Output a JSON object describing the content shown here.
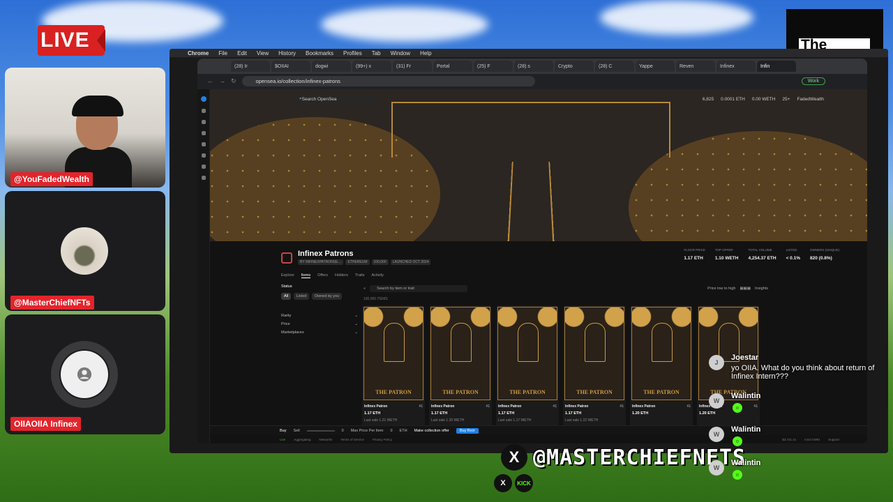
{
  "overlay": {
    "live_label": "LIVE",
    "brand_text": "The Crypto Bunker",
    "handle_text": "@MASTERCHIEFNFTS",
    "x_icon": "X",
    "kick_icon": "KICK"
  },
  "cams": [
    {
      "name": "@YouFadedWealth"
    },
    {
      "name": "@MasterChiefNFTs"
    },
    {
      "name": "OIIAOIIA Infinex"
    }
  ],
  "mac_menu": [
    "Chrome",
    "File",
    "Edit",
    "View",
    "History",
    "Bookmarks",
    "Profiles",
    "Tab",
    "Window",
    "Help"
  ],
  "browser": {
    "tabs": [
      "(28) Ir",
      "$OIIAI",
      "dogwi",
      "(99+) x",
      "(31) Fr",
      "Portal",
      "(25) F",
      "(28) s",
      "Crypto",
      "(28) C",
      "Yappe",
      "Reven",
      "Infinex",
      "Infin"
    ],
    "url": "opensea.io/collection/infinex-patrons",
    "work_label": "Work"
  },
  "opensea": {
    "search_placeholder": "Search OpenSea",
    "nav_stats": [
      "6,825",
      "0.0001 ETH",
      "0.00 WETH",
      "25+",
      "FadedWealth"
    ],
    "collection_name": "Infinex Patrons",
    "chips": [
      "BY INFINEXPATRONSE…",
      "ETHEREUM",
      "100,000",
      "LAUNCHED OCT 2024"
    ],
    "stats": [
      {
        "label": "FLOOR PRICE",
        "value": "1.17 ETH"
      },
      {
        "label": "TOP OFFER",
        "value": "1.10 WETH"
      },
      {
        "label": "TOTAL VOLUME",
        "value": "4,254.37 ETH"
      },
      {
        "label": "LISTED",
        "value": "< 0.1%"
      },
      {
        "label": "OWNERS (UNIQUE)",
        "value": "820 (0.8%)"
      }
    ],
    "subtabs": [
      "Explore",
      "Items",
      "Offers",
      "Holders",
      "Traits",
      "Activity"
    ],
    "status_label": "Status",
    "status_pills": [
      "All",
      "Listed",
      "Owned by you"
    ],
    "filter_rows": [
      "Rarity",
      "Price",
      "Marketplaces"
    ],
    "item_search_placeholder": "Search by item or trait",
    "sort_label": "Price low to high",
    "insights_label": "Insights",
    "items_count": "100,000 ITEMS",
    "cards": [
      {
        "name": "Infinex Patron",
        "rank": "#1",
        "price": "1.17 ETH",
        "last": "Last sale 1.21 WETH",
        "art": "THE PATRON"
      },
      {
        "name": "Infinex Patron",
        "rank": "#1",
        "price": "1.17 ETH",
        "last": "Last sale 1.20 WETH",
        "art": "THE PATRON"
      },
      {
        "name": "Infinex Patron",
        "rank": "#1",
        "price": "1.17 ETH",
        "last": "Last sale 1.17 WETH",
        "art": "THE PATRON"
      },
      {
        "name": "Infinex Patron",
        "rank": "#1",
        "price": "1.17 ETH",
        "last": "Last sale 1.22 WETH",
        "art": "THE PATRON"
      },
      {
        "name": "Infinex Patron",
        "rank": "#1",
        "price": "1.20 ETH",
        "last": "",
        "art": "THE PATRON"
      },
      {
        "name": "Infinex Patron",
        "rank": "#1",
        "price": "1.20 ETH",
        "last": "",
        "art": "THE PATRON"
      }
    ],
    "bottom": {
      "buy": "Buy",
      "sell": "Sell",
      "qty": "0",
      "max_price": "Max Price Per Item",
      "price_val": "0",
      "currency": "ETH",
      "make_offer": "Make collection offer",
      "buy_floor": "Buy floor"
    },
    "statusbar": [
      "Live",
      "Aggregating",
      "Networks",
      "Terms of Service",
      "Privacy Policy",
      "$3,721.41",
      "0.63 GWEI",
      "Support"
    ]
  },
  "chat": [
    {
      "user": "Joestar",
      "message": "yo OIIA. What do you think about return of Infinex Intern???",
      "avatar": "J"
    },
    {
      "user": "Walintin",
      "message": "",
      "avatar": "W"
    },
    {
      "user": "Walintin",
      "message": "",
      "avatar": "W"
    },
    {
      "user": "Walintin",
      "message": "",
      "avatar": "W"
    }
  ]
}
